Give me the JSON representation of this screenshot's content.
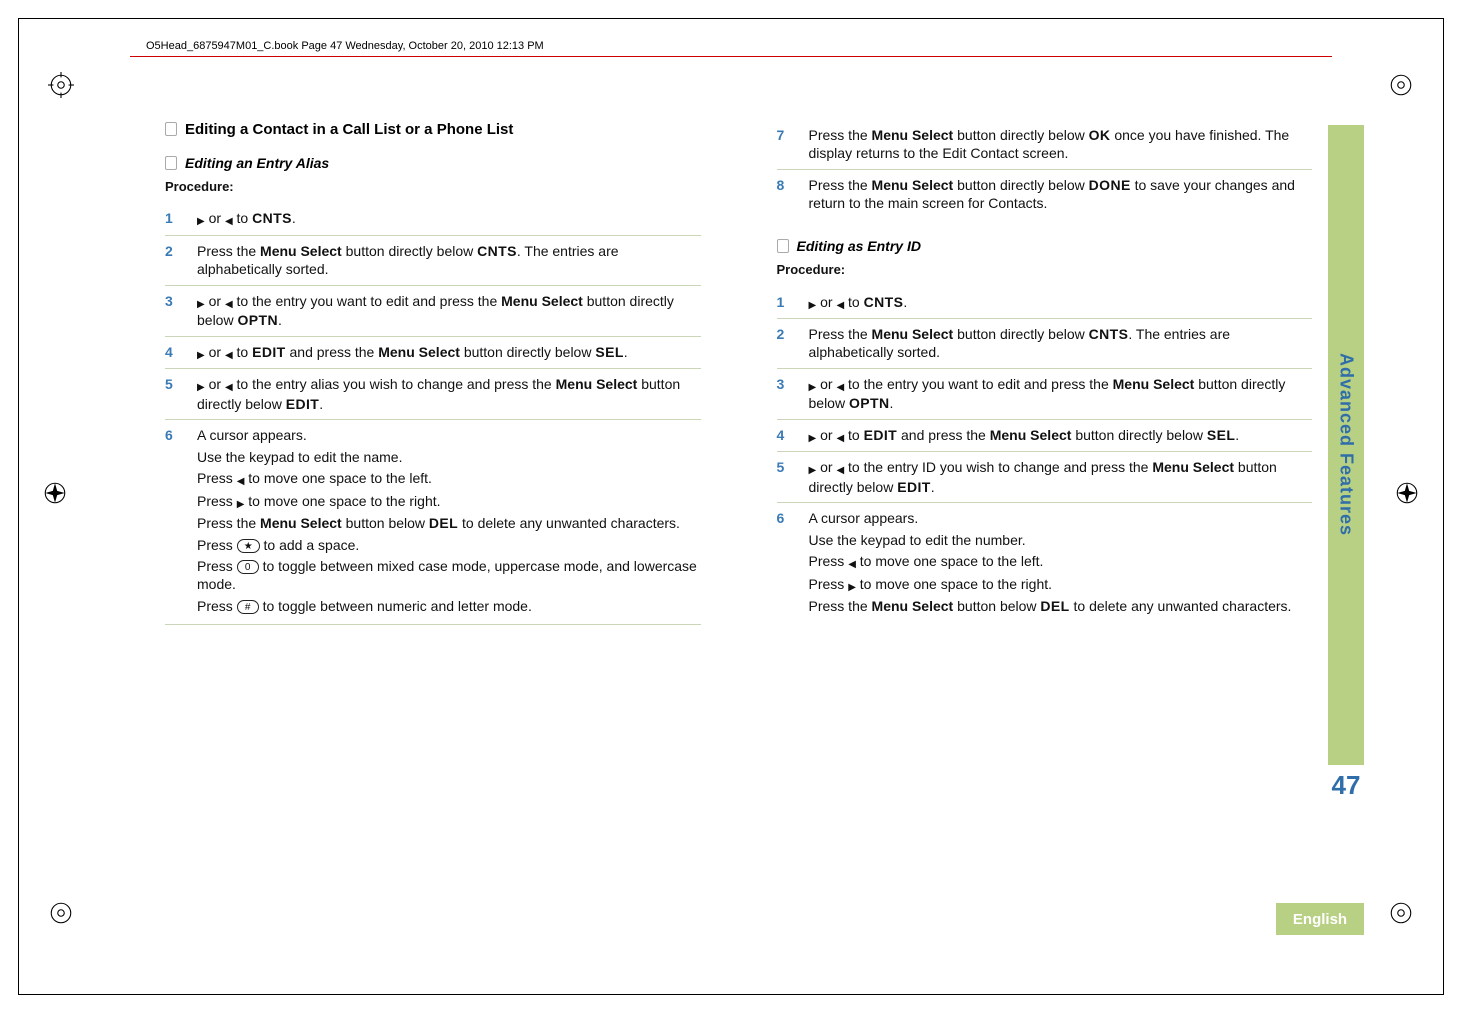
{
  "running_header": "O5Head_6875947M01_C.book  Page 47  Wednesday, October 20, 2010  12:13 PM",
  "side_tab": "Advanced Features",
  "page_number": "47",
  "language_label": "English",
  "left": {
    "section_heading": "Editing a Contact in a Call List or a Phone List",
    "sub_heading": "Editing an Entry Alias",
    "procedure_label": "Procedure:",
    "steps": {
      "1": {
        "num": "1",
        "pre": "",
        "between": " or ",
        "post": " to ",
        "code": "CNTS",
        "tail": "."
      },
      "2": {
        "num": "2",
        "pre": "Press the ",
        "bold": "Menu Select",
        "mid": " button directly below ",
        "code": "CNTS",
        "tail": ". The entries are alphabetically sorted."
      },
      "3": {
        "num": "3",
        "between": " or ",
        "mid": " to the entry you want to edit and press the ",
        "bold": "Menu Select",
        "mid2": " button directly below ",
        "code": "OPTN",
        "tail": "."
      },
      "4": {
        "num": "4",
        "between": " or ",
        "mid": " to ",
        "code": "EDIT",
        "mid2": " and press the ",
        "bold": "Menu Select",
        "mid3": " button directly below ",
        "code2": "SEL",
        "tail": "."
      },
      "5": {
        "num": "5",
        "between": " or ",
        "mid": " to the entry alias you wish to change and press the ",
        "bold": "Menu Select",
        "mid2": " button directly below ",
        "code": "EDIT",
        "tail": "."
      },
      "6": {
        "num": "6",
        "l1": "A cursor appears.",
        "l2": "Use the keypad to edit the name.",
        "l3_pre": "Press ",
        "l3_post": " to move one space to the left.",
        "l4_pre": "Press ",
        "l4_post": " to move one space to the right.",
        "l5_pre": "Press the ",
        "l5_bold": "Menu Select",
        "l5_mid": " button below ",
        "l5_code": "DEL",
        "l5_post": " to delete any unwanted characters.",
        "l6_pre": "Press ",
        "l6_key": "★",
        "l6_post": " to add a space.",
        "l7_pre": "Press ",
        "l7_key": "0",
        "l7_post": " to toggle between mixed case mode, uppercase mode, and lowercase mode.",
        "l8_pre": "Press ",
        "l8_key": "#",
        "l8_post": " to toggle between numeric and letter mode."
      }
    }
  },
  "right": {
    "steps_top": {
      "7": {
        "num": "7",
        "pre": "Press the ",
        "bold": "Menu Select",
        "mid": " button directly below ",
        "code": "OK",
        "tail": " once you have finished. The display returns to the Edit Contact screen."
      },
      "8": {
        "num": "8",
        "pre": "Press the ",
        "bold": "Menu Select",
        "mid": " button directly below ",
        "code": "DONE",
        "tail": " to save your changes and return to the main screen for Contacts."
      }
    },
    "sub_heading": "Editing as Entry ID",
    "procedure_label": "Procedure:",
    "steps": {
      "1": {
        "num": "1",
        "between": " or ",
        "post": " to ",
        "code": "CNTS",
        "tail": "."
      },
      "2": {
        "num": "2",
        "pre": "Press the ",
        "bold": "Menu Select",
        "mid": " button directly below ",
        "code": "CNTS",
        "tail": ". The entries are alphabetically sorted."
      },
      "3": {
        "num": "3",
        "between": " or ",
        "mid": " to the entry you want to edit and press the ",
        "bold": "Menu Select",
        "mid2": " button directly below ",
        "code": "OPTN",
        "tail": "."
      },
      "4": {
        "num": "4",
        "between": " or ",
        "mid": " to ",
        "code": "EDIT",
        "mid2": " and press the ",
        "bold": "Menu Select",
        "mid3": " button directly below ",
        "code2": "SEL",
        "tail": "."
      },
      "5": {
        "num": "5",
        "between": " or ",
        "mid": " to the entry ID you wish to change and press the ",
        "bold": "Menu Select",
        "mid2": " button directly below ",
        "code": "EDIT",
        "tail": "."
      },
      "6": {
        "num": "6",
        "l1": "A cursor appears.",
        "l2": "Use the keypad to edit the number.",
        "l3_pre": "Press ",
        "l3_post": " to move one space to the left.",
        "l4_pre": "Press ",
        "l4_post": " to move one space to the right.",
        "l5_pre": "Press the ",
        "l5_bold": "Menu Select",
        "l5_mid": " button below ",
        "l5_code": "DEL",
        "l5_post": " to delete any unwanted characters."
      }
    }
  }
}
